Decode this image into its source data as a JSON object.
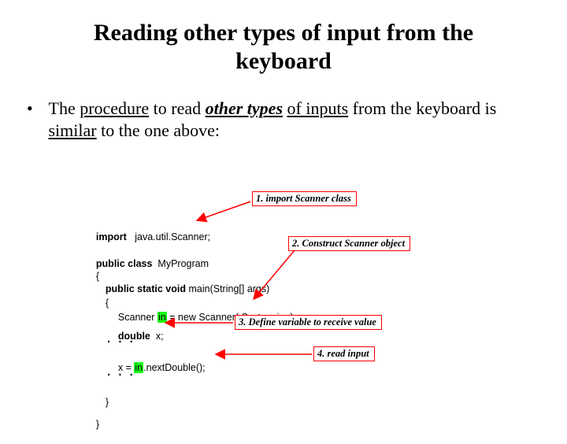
{
  "title_line1": "Reading other types of input from the",
  "title_line2": "keyboard",
  "bullet_pre": "The ",
  "bullet_u1": "procedure",
  "bullet_mid1": " to read ",
  "bullet_em_u": "other types",
  "bullet_mid2": " ",
  "bullet_u2": "of inputs",
  "bullet_mid3": " from the keyboard is ",
  "bullet_u3": "similar",
  "bullet_post": " to the one above:",
  "code": {
    "l1_a": "import",
    "l1_b": "   java.util.Scanner;",
    "l2_a": "public class",
    "l2_b": "  MyProgram",
    "l3": "{",
    "l4_a": "public static void",
    "l4_b": " main(String[] args)",
    "l5": "{",
    "l6_a": "Scanner ",
    "l6_hl": "in",
    "l6_b": " = new Scanner( System.in  );",
    "l7_a": "double",
    "l7_b": "  x;",
    "l8_a": "x = ",
    "l8_hl": "in",
    "l8_b": ".nextDouble();",
    "l9": "}",
    "l10": "}",
    "dots": ". . ."
  },
  "steps": {
    "s1": "1. import  Scanner class",
    "s2": "2. Construct Scanner object",
    "s3": "3. Define variable to receive value",
    "s4": "4. read input"
  }
}
